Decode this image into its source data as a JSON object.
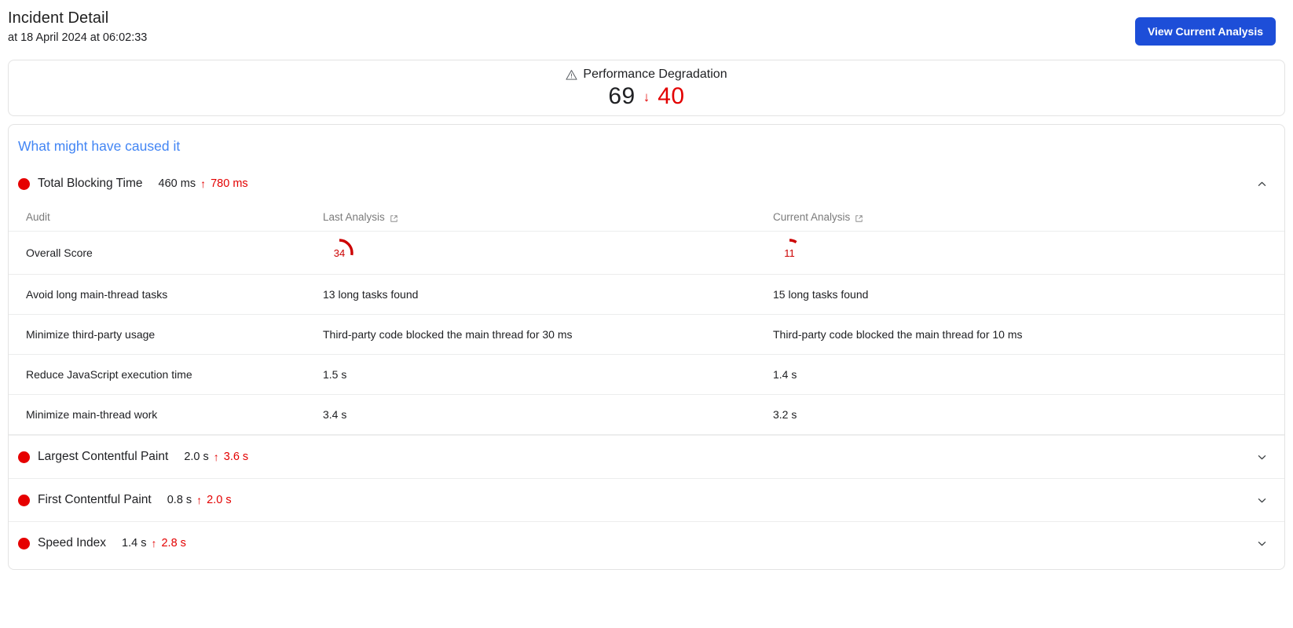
{
  "header": {
    "title": "Incident Detail",
    "subtitle": "at 18 April 2024 at 06:02:33",
    "action_label": "View Current Analysis"
  },
  "degradation": {
    "icon": "warning-triangle-icon",
    "label": "Performance Degradation",
    "score_before": "69",
    "arrow": "↓",
    "score_after": "40",
    "accent_color": "#e30000"
  },
  "causes": {
    "title": "What might have caused it",
    "metrics": [
      {
        "status_color": "#e60000",
        "name": "Total Blocking Time",
        "value_before": "460 ms",
        "arrow": "↑",
        "value_after": "780 ms",
        "expanded": true,
        "chevron": "chevron-up-icon",
        "table": {
          "columns": [
            {
              "label": "Audit",
              "link_icon": false
            },
            {
              "label": "Last Analysis",
              "link_icon": true
            },
            {
              "label": "Current Analysis",
              "link_icon": true
            }
          ],
          "rows": [
            {
              "audit": "Overall Score",
              "type": "gauge",
              "last": "34",
              "current": "11"
            },
            {
              "audit": "Avoid long main-thread tasks",
              "type": "text",
              "last": "13 long tasks found",
              "current": "15 long tasks found"
            },
            {
              "audit": "Minimize third-party usage",
              "type": "text",
              "last": "Third-party code blocked the main thread for 30 ms",
              "current": "Third-party code blocked the main thread for 10 ms"
            },
            {
              "audit": "Reduce JavaScript execution time",
              "type": "text",
              "last": "1.5 s",
              "current": "1.4 s"
            },
            {
              "audit": "Minimize main-thread work",
              "type": "text",
              "last": "3.4 s",
              "current": "3.2 s"
            }
          ]
        }
      },
      {
        "status_color": "#e60000",
        "name": "Largest Contentful Paint",
        "value_before": "2.0 s",
        "arrow": "↑",
        "value_after": "3.6 s",
        "expanded": false,
        "chevron": "chevron-down-icon"
      },
      {
        "status_color": "#e60000",
        "name": "First Contentful Paint",
        "value_before": "0.8 s",
        "arrow": "↑",
        "value_after": "2.0 s",
        "expanded": false,
        "chevron": "chevron-down-icon"
      },
      {
        "status_color": "#e60000",
        "name": "Speed Index",
        "value_before": "1.4 s",
        "arrow": "↑",
        "value_after": "2.8 s",
        "expanded": false,
        "chevron": "chevron-down-icon"
      }
    ]
  }
}
